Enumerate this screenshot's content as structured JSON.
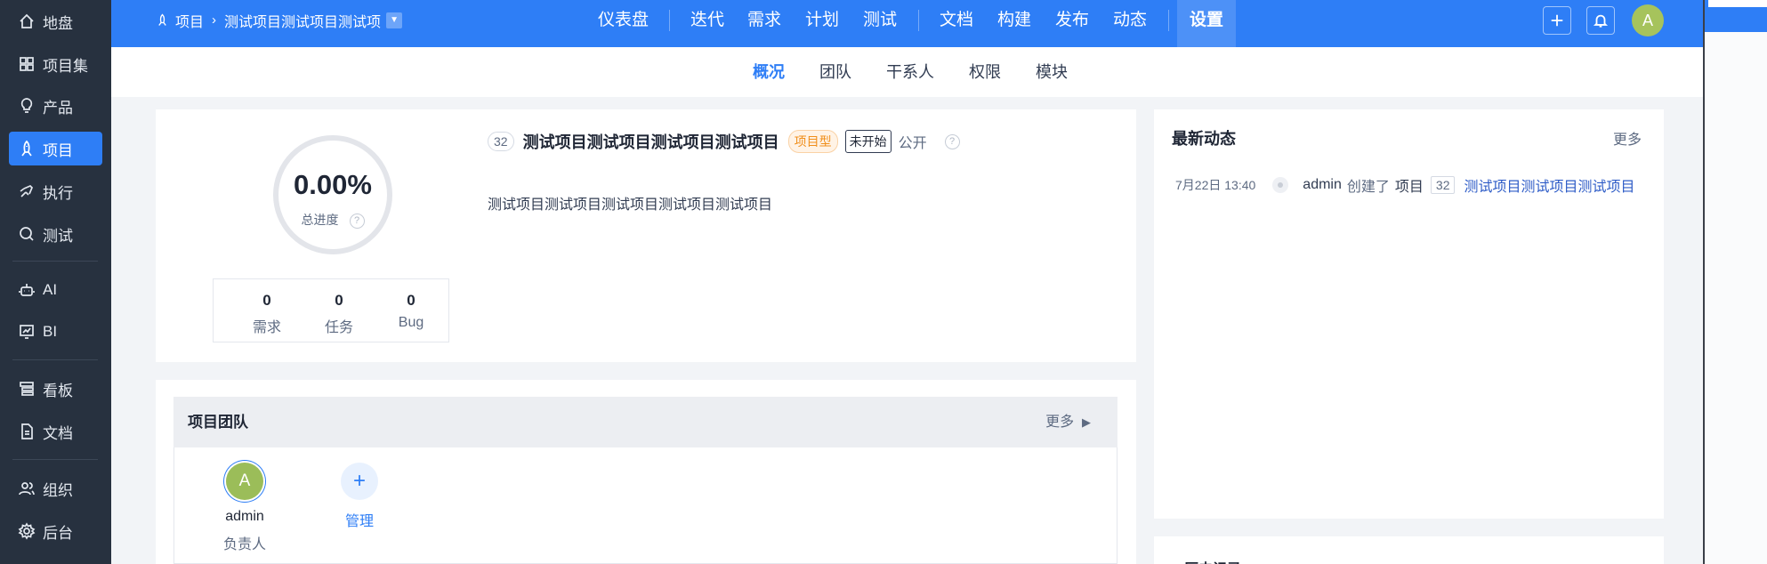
{
  "sidebar": {
    "items": [
      {
        "label": "地盘",
        "icon": "home-icon"
      },
      {
        "label": "项目集",
        "icon": "grid-icon"
      },
      {
        "label": "产品",
        "icon": "bulb-icon"
      },
      {
        "label": "项目",
        "icon": "rocket-icon",
        "active": true
      },
      {
        "label": "执行",
        "icon": "run-icon"
      },
      {
        "label": "测试",
        "icon": "test-icon"
      },
      {
        "label": "AI",
        "icon": "robot-icon"
      },
      {
        "label": "BI",
        "icon": "chart-icon"
      },
      {
        "label": "看板",
        "icon": "board-icon"
      },
      {
        "label": "文档",
        "icon": "doc-icon"
      },
      {
        "label": "组织",
        "icon": "users-icon"
      },
      {
        "label": "后台",
        "icon": "gear-icon"
      }
    ]
  },
  "topbar": {
    "breadcrumb_root": "项目",
    "breadcrumb_project": "测试项目测试项目测试项",
    "nav": [
      "仪表盘",
      "迭代",
      "需求",
      "计划",
      "测试",
      "文档",
      "构建",
      "发布",
      "动态",
      "设置"
    ],
    "active_nav": "设置",
    "avatar": "A"
  },
  "subnav": {
    "items": [
      "概况",
      "团队",
      "干系人",
      "权限",
      "模块"
    ],
    "active": "概况"
  },
  "overview": {
    "progress": "0.00%",
    "progress_label": "总进度",
    "stats": [
      {
        "value": "0",
        "label": "需求"
      },
      {
        "value": "0",
        "label": "任务"
      },
      {
        "value": "0",
        "label": "Bug"
      }
    ],
    "project_id": "32",
    "project_title": "测试项目测试项目测试项目测试项目",
    "type_tag": "项目型",
    "status_tag": "未开始",
    "visibility": "公开",
    "description": "测试项目测试项目测试项目测试项目测试项目"
  },
  "team": {
    "title": "项目团队",
    "more": "更多",
    "members": [
      {
        "avatar": "A",
        "name": "admin",
        "role": "负责人"
      }
    ],
    "add_label": "管理",
    "add_symbol": "+"
  },
  "dynamics": {
    "title": "最新动态",
    "more": "更多",
    "items": [
      {
        "time": "7月22日 13:40",
        "user": "admin",
        "action": "创建了",
        "object": "项目",
        "id": "32",
        "link": "测试项目测试项目测试项目"
      }
    ]
  },
  "history": {
    "title": "历史记录"
  },
  "colors": {
    "primary": "#2e7ef6",
    "sidebar": "#27313f",
    "tag_orange": "#f08f1c",
    "avatar_green": "#a6c35c"
  }
}
